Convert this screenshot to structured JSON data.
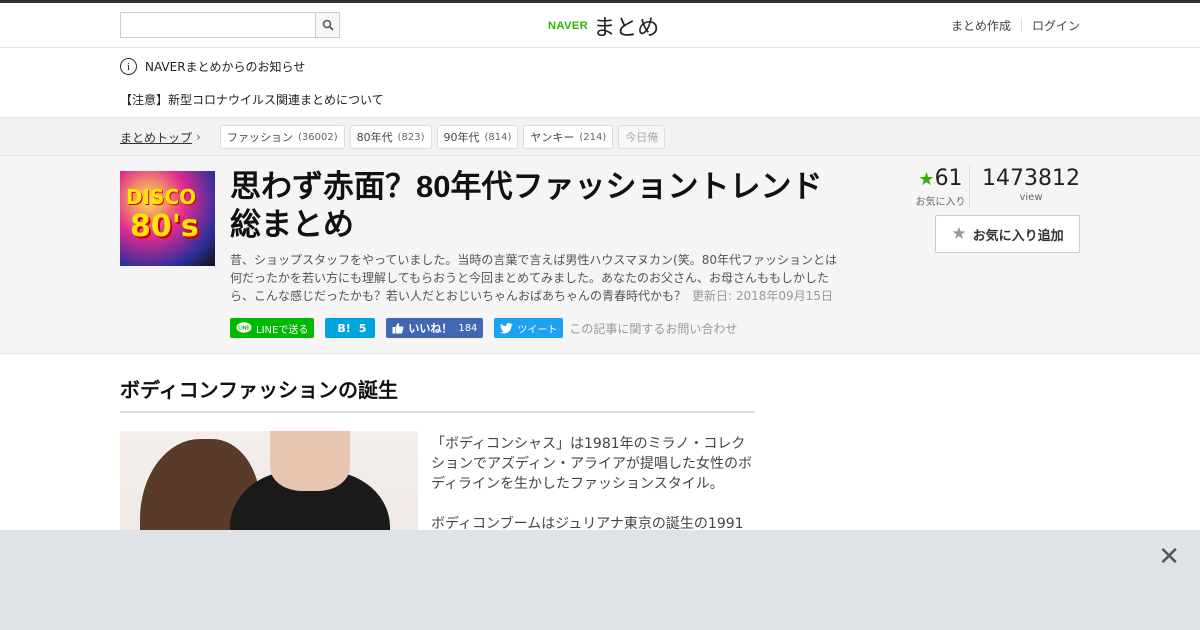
{
  "header": {
    "search_placeholder": "",
    "logo_brand": "NAVER",
    "logo_name": "まとめ",
    "nav": [
      "まとめ作成",
      "ログイン"
    ]
  },
  "notice": {
    "title": "NAVERまとめからのお知らせ",
    "item": "【注意】新型コロナウイルス関連まとめについて"
  },
  "breadcrumb": {
    "home": "まとめトップ",
    "tags": [
      {
        "label": "ファッション",
        "count": "(36002)"
      },
      {
        "label": "80年代",
        "count": "(823)"
      },
      {
        "label": "90年代",
        "count": "(814)"
      },
      {
        "label": "ヤンキー",
        "count": "(214)"
      },
      {
        "label": "今日俺",
        "count": ""
      }
    ]
  },
  "article": {
    "thumb_text_1": "DISCO",
    "thumb_text_2": "80's",
    "title": "思わず赤面？80年代ファッショントレンド総まとめ",
    "description": "昔、ショップスタッフをやっていました。当時の言葉で言えば男性ハウスマヌカン(笑。80年代ファッションとは何だったかを若い方にも理解してもらおうと今回まとめてみました。あなたのお父さん、お母さんももしかしたら、こんな感じだったかも？若い人だとおじいちゃんおばあちゃんの青春時代かも？",
    "updated": "更新日: 2018年09月15日",
    "favorites": "61",
    "favorites_label": "お気に入り",
    "views": "1473812",
    "views_label": "view",
    "fav_button": "お気に入り追加"
  },
  "share": {
    "line": "LINEで送る",
    "hatena_icon": "B!",
    "hatena_count": "5",
    "fb_label": "いいね！",
    "fb_count": "184",
    "tweet": "ツイート",
    "inquiry": "この記事に関するお問い合わせ"
  },
  "section": {
    "heading": "ボディコンファッションの誕生",
    "para1": "「ボディコンシャス」は1981年のミラノ・コレクションでアズディン・アライアが提唱した女性のボディラインを生かしたファッションスタイル。",
    "para2": "ボディコンブームはジュリアナ東京の誕生の1991"
  },
  "ad": {
    "close_icon": "close-icon"
  },
  "colors": {
    "brand": "#2db400",
    "line": "#00b900",
    "hatena": "#00a4de",
    "facebook": "#4267b2",
    "twitter": "#1da1f2"
  }
}
